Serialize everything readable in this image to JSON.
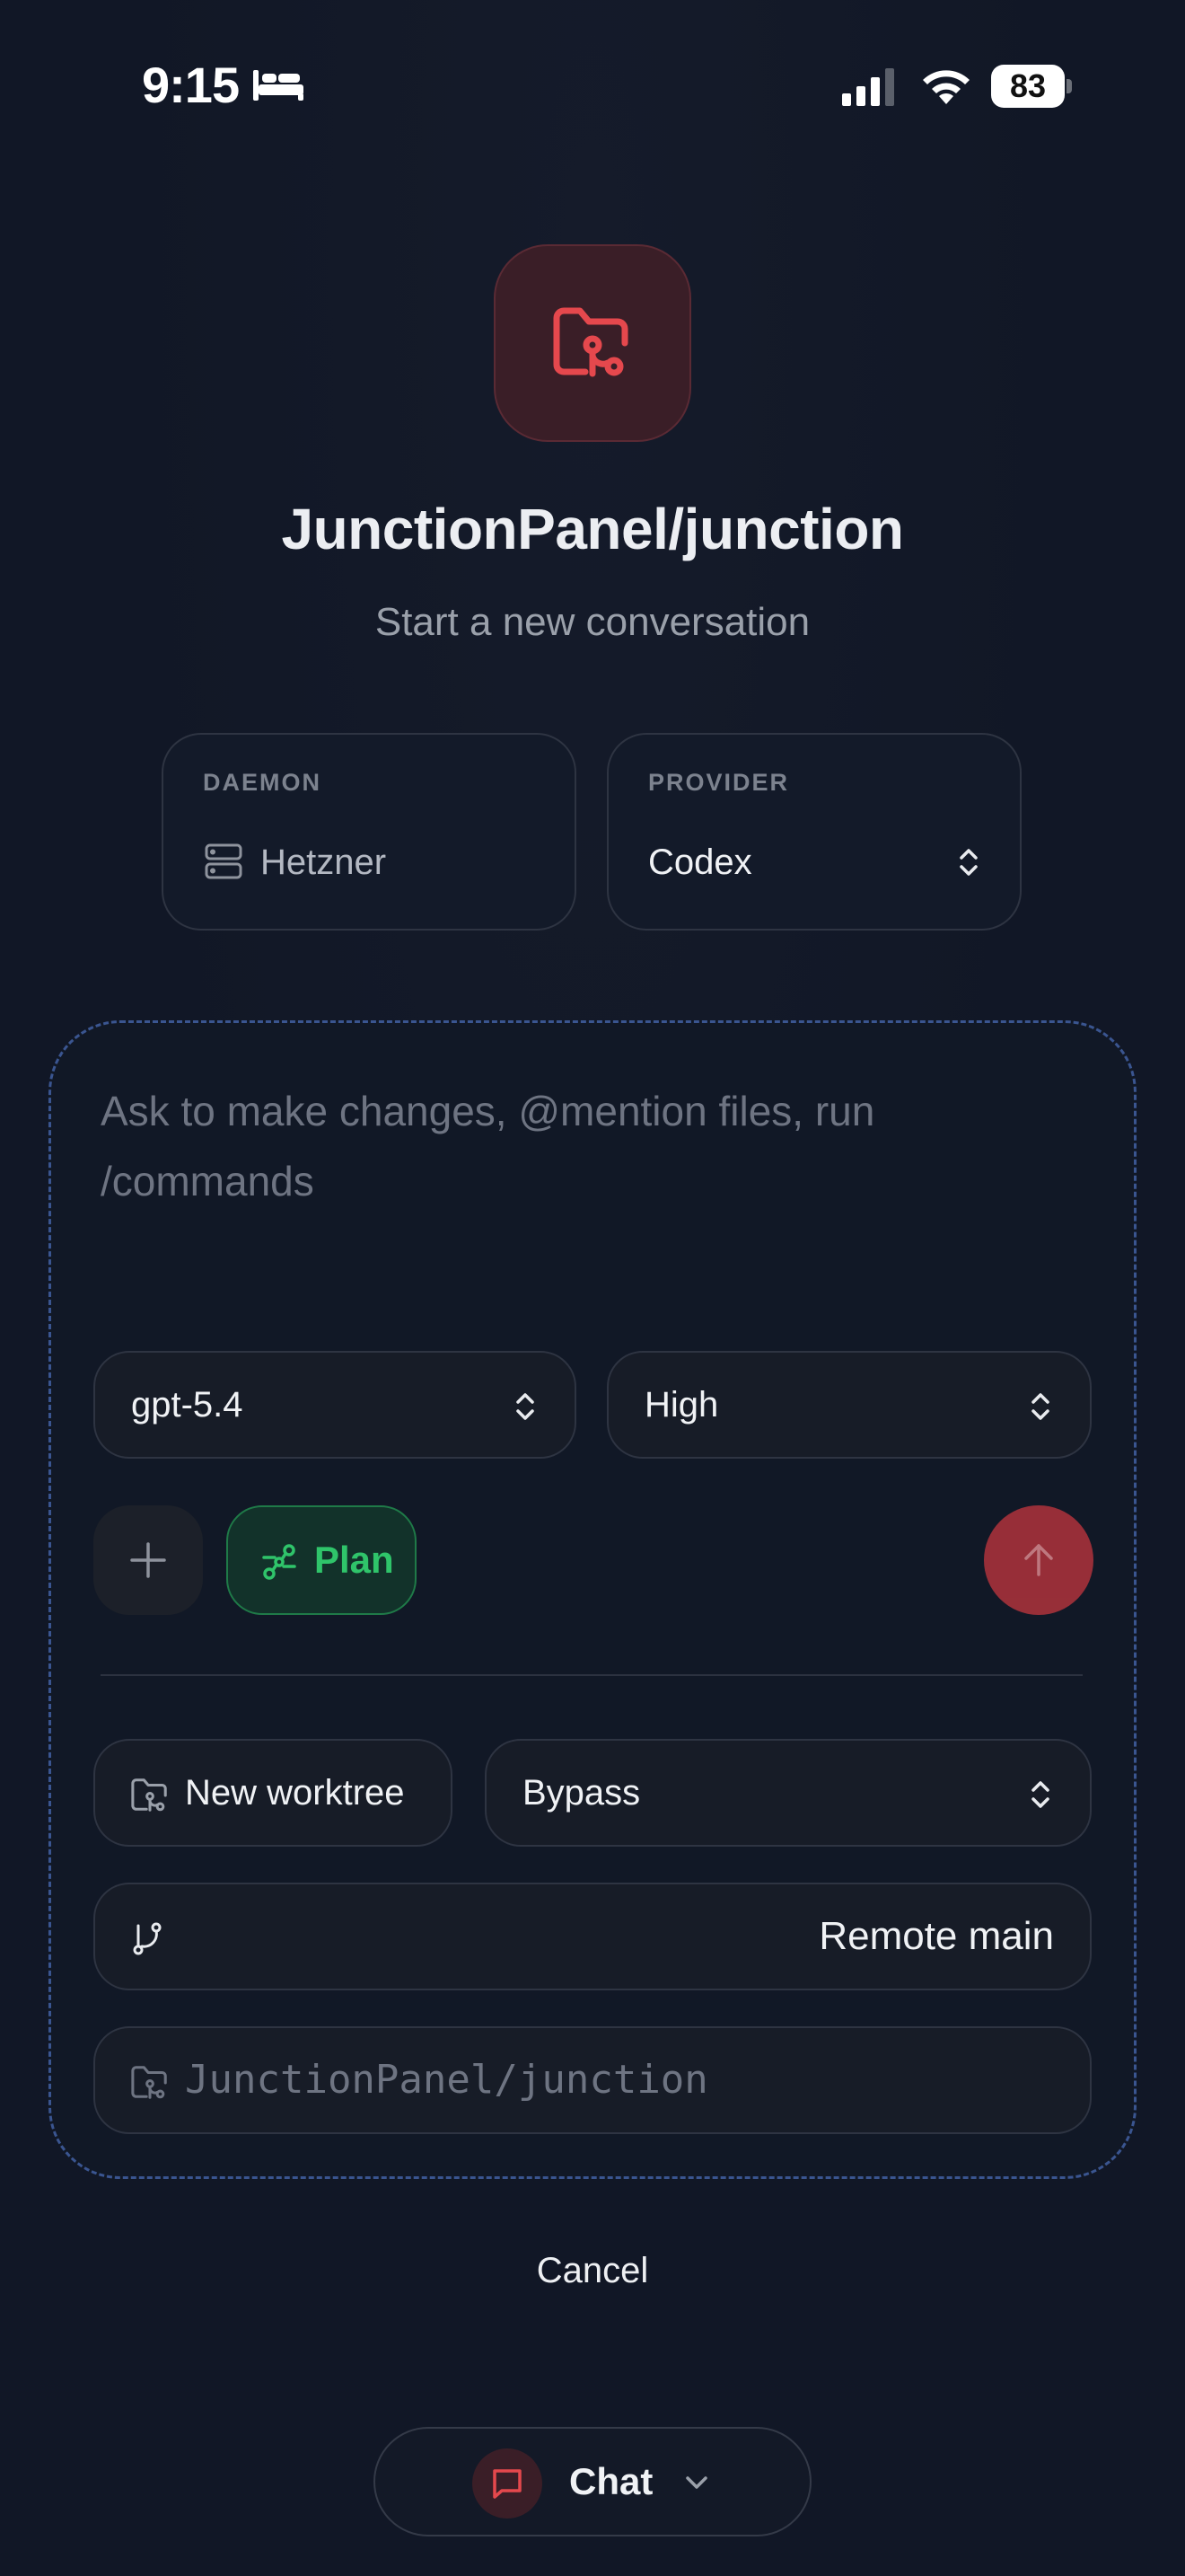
{
  "status_bar": {
    "time": "9:15",
    "battery": "83",
    "icons": [
      "bed-icon",
      "cellular-signal-icon",
      "wifi-icon",
      "battery-icon"
    ]
  },
  "header": {
    "icon": "folder-git-icon",
    "title": "JunctionPanel/junction",
    "subtitle": "Start a new conversation"
  },
  "selectors": {
    "daemon": {
      "label": "DAEMON",
      "value": "Hetzner",
      "icon": "server-icon"
    },
    "provider": {
      "label": "PROVIDER",
      "value": "Codex",
      "icon": "chevron-up-down-icon"
    }
  },
  "composer": {
    "placeholder": "Ask to make changes, @mention files, run /commands",
    "model": "gpt-5.4",
    "effort": "High",
    "plan_label": "Plan",
    "worktree_label": "New worktree",
    "permission_mode": "Bypass",
    "branch": "Remote main",
    "path": "JunctionPanel/junction"
  },
  "actions": {
    "cancel": "Cancel"
  },
  "bottom_bar": {
    "mode": "Chat"
  },
  "colors": {
    "background": "#111726",
    "accent_red": "#e5484d",
    "plan_green": "#2fc46a",
    "composer_border": "#3a5590"
  }
}
